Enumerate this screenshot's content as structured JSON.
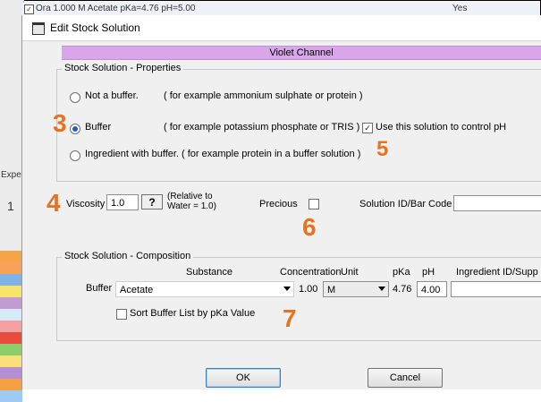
{
  "background": {
    "row_text": "Ora     1.000 M Acetate  pKa=4.76 pH=5.00",
    "row_value": "Yes",
    "left_label": "Expe",
    "left_digit": "1"
  },
  "dialog": {
    "title": "Edit Stock Solution",
    "channel": "Violet Channel",
    "properties": {
      "group_label": "Stock Solution - Properties",
      "options": [
        {
          "label": "Not a buffer.",
          "example": "( for example ammonium sulphate or protein )",
          "selected": false
        },
        {
          "label": "Buffer",
          "example": "( for example potassium phosphate or TRIS )",
          "selected": true
        },
        {
          "label": "Ingredient with buffer.  ( for example protein in a buffer solution )",
          "example": "",
          "selected": false
        }
      ],
      "control_ph_label": "Use this solution to control pH",
      "control_ph_checked": true
    },
    "viscosity": {
      "label": "Viscosity",
      "value": "1.0",
      "help_button": "?",
      "note_line1": "(Relative to",
      "note_line2": "Water = 1.0)"
    },
    "precious": {
      "label": "Precious",
      "checked": false
    },
    "solution_id": {
      "label": "Solution ID/Bar Code",
      "value": ""
    },
    "composition": {
      "group_label": "Stock Solution - Composition",
      "headers": {
        "substance": "Substance",
        "concentration": "Concentration",
        "unit": "Unit",
        "pka": "pKa",
        "ph": "pH",
        "ingredient_id": "Ingredient ID/Supp"
      },
      "row_label": "Buffer",
      "substance": "Acetate",
      "concentration": "1.00",
      "unit": "M",
      "pka": "4.76",
      "ph": "4.00",
      "ingredient_id": ""
    },
    "sort_label": "Sort Buffer List by pKa Value",
    "sort_checked": false,
    "ok_label": "OK",
    "cancel_label": "Cancel"
  },
  "callouts": [
    "3",
    "4",
    "5",
    "6",
    "7"
  ],
  "colors": {
    "callout": "#e57321",
    "channel_band": "#d9a6ea",
    "radio_selected": "#1f5fbf"
  },
  "swatch_colors": [
    "#f4a54a",
    "#f7a15a",
    "#7fb3e8",
    "#f7e46a",
    "#c39bd3",
    "#d6eaf8",
    "#f4a1a1",
    "#e74c3c",
    "#8bcf6b",
    "#fbe07a",
    "#b48fd6",
    "#f5a142",
    "#9ecbf2"
  ]
}
